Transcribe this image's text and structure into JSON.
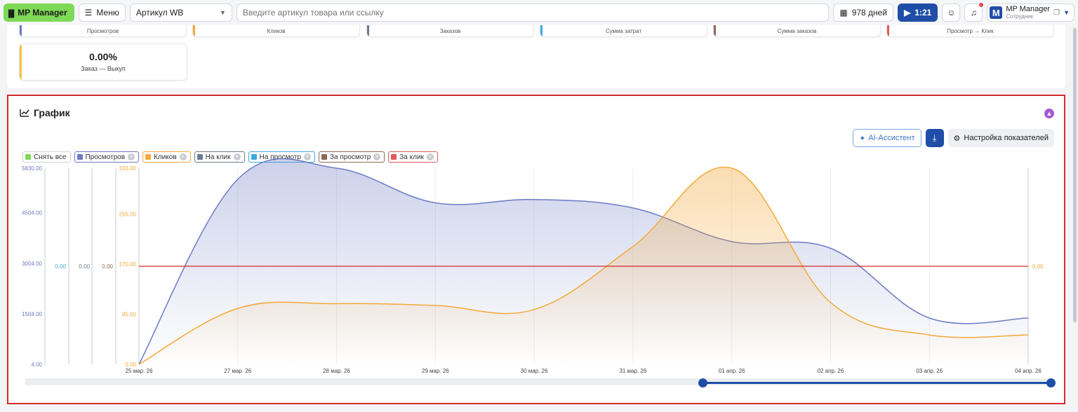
{
  "topbar": {
    "logo": "MP Manager",
    "menu": "Меню",
    "article_select": "Артикул WB",
    "search_placeholder": "Введите артикул товара или ссылку",
    "days": "978 дней",
    "video_timer": "1:21",
    "user_name": "MP Manager",
    "user_role": "Сотрудник"
  },
  "metrics_cut": [
    {
      "label": "Просмотров",
      "color": "#6c7bc4"
    },
    {
      "label": "Кликов",
      "color": "#f4a93b"
    },
    {
      "label": "Заказов",
      "color": "#6b7c8f"
    },
    {
      "label": "Сумма затрат",
      "color": "#3fa8dd"
    },
    {
      "label": "Сумма заказов",
      "color": "#8a6a55"
    },
    {
      "label": "Просмотр → Клик",
      "color": "#e05a5a"
    }
  ],
  "metric_big": {
    "value": "0.00%",
    "label": "Заказ — Выкуп",
    "color": "#f4c242"
  },
  "panel": {
    "title": "График",
    "ai_button": "AI-Ассистент",
    "settings_button": "Настройка показателей"
  },
  "legend": [
    {
      "label": "Снять все",
      "color": "#7ed957",
      "border": "#cfd3d8",
      "removable": false
    },
    {
      "label": "Просмотров",
      "color": "#6c7bc4",
      "border": "#6c7bc4",
      "removable": true
    },
    {
      "label": "Кликов",
      "color": "#f4a93b",
      "border": "#f4a93b",
      "removable": true
    },
    {
      "label": "На клик",
      "color": "#6b7c8f",
      "border": "#6b7c8f",
      "removable": true
    },
    {
      "label": "На просмотр",
      "color": "#3fa8dd",
      "border": "#3fa8dd",
      "removable": true
    },
    {
      "label": "За просмотр",
      "color": "#8a6a55",
      "border": "#8a6a55",
      "removable": true
    },
    {
      "label": "За клик",
      "color": "#e05a5a",
      "border": "#e05a5a",
      "removable": true
    }
  ],
  "chart_data": {
    "type": "area",
    "categories": [
      "25 мар. 26",
      "27 мар. 26",
      "28 мар. 26",
      "29 мар. 26",
      "30 мар. 26",
      "31 мар. 26",
      "01 апр. 26",
      "02 апр. 26",
      "03 апр. 26",
      "04 апр. 26"
    ],
    "series": [
      {
        "name": "Просмотров",
        "color": "#6c7bc4",
        "axis": "left1",
        "values": [
          4,
          5500,
          5830,
          4800,
          4900,
          4650,
          3650,
          3450,
          1380,
          1380
        ]
      },
      {
        "name": "Кликов",
        "color": "#f4a93b",
        "axis": "left2",
        "values": [
          0,
          95,
          103,
          100,
          93,
          200,
          333,
          105,
          50,
          50
        ]
      },
      {
        "name": "За клик",
        "color": "#d42a2a",
        "axis": "left3",
        "values": [
          0,
          0,
          0,
          0,
          0,
          0,
          0,
          0,
          0,
          0
        ]
      }
    ],
    "axes": {
      "left1": {
        "ticks": [
          "4.00",
          "1504.00",
          "3004.00",
          "4504.00",
          "5830.00"
        ],
        "color": "#6c7bc4",
        "range": [
          4,
          5830
        ]
      },
      "left2": {
        "ticks": [
          "0.00",
          "85.00",
          "170.00",
          "255.00",
          "333.00"
        ],
        "color": "#f4a93b",
        "range": [
          0,
          333
        ]
      },
      "mid_labels": [
        {
          "text": "0.00",
          "color": "#3fa8dd"
        },
        {
          "text": "0.00",
          "color": "#6b7c8f"
        },
        {
          "text": "0.00",
          "color": "#8a6a55"
        }
      ],
      "right": {
        "text": "0,00",
        "color": "#f4a93b"
      }
    },
    "grid": true
  },
  "slider": {
    "start": 0.66,
    "end": 1.0
  }
}
